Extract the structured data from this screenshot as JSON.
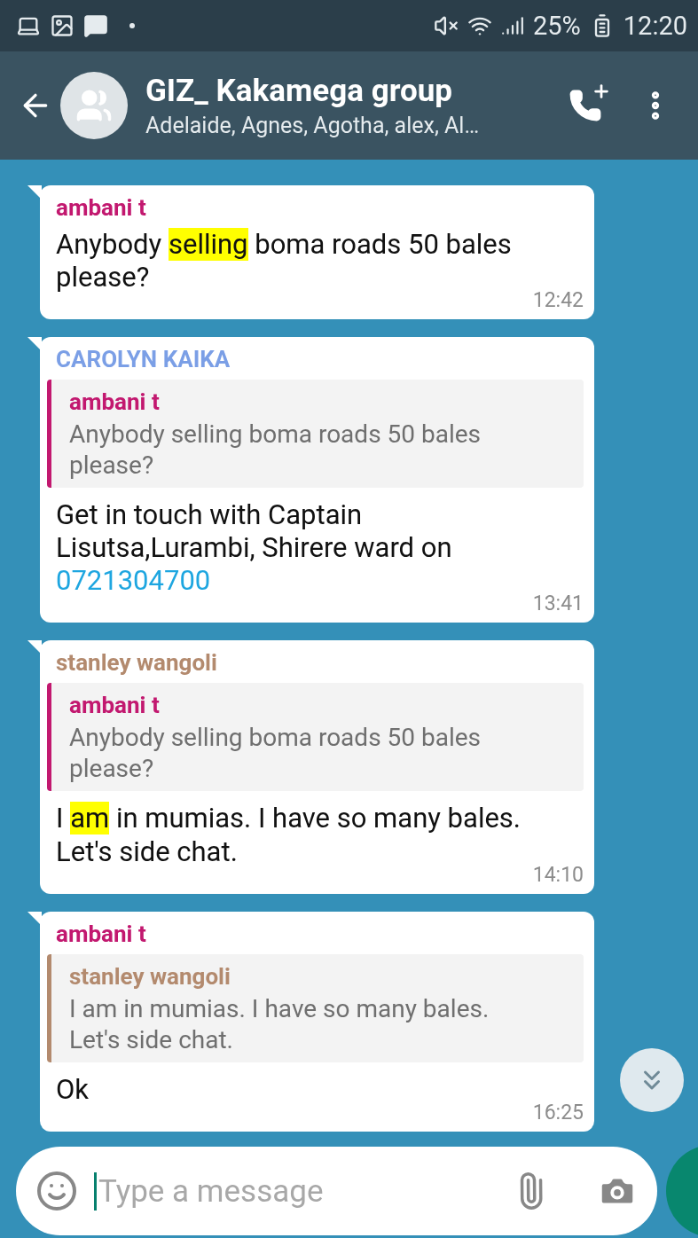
{
  "status_bar": {
    "battery": "25%",
    "time": "12:20"
  },
  "header": {
    "title": "GIZ_ Kakamega group",
    "subtitle": "Adelaide, Agnes, Agotha, alex, Al…"
  },
  "messages": [
    {
      "sender": "ambani t",
      "color": "#c2186f",
      "parts": [
        {
          "kind": "text",
          "text": "Anybody "
        },
        {
          "kind": "highlight",
          "text": "selling"
        },
        {
          "kind": "text",
          "text": " boma roads 50 bales please?"
        }
      ],
      "time": "12:42"
    },
    {
      "sender": "CAROLYN KAIKA",
      "color": "#7b9fe6",
      "quote": {
        "sender": "ambani t",
        "color": "#c2186f",
        "text": "Anybody selling boma roads 50 bales please?"
      },
      "parts": [
        {
          "kind": "text",
          "text": "Get in touch with Captain Lisutsa,Lurambi, Shirere ward on "
        },
        {
          "kind": "link",
          "text": "0721304700"
        }
      ],
      "time": "13:41"
    },
    {
      "sender": "stanley wangoli",
      "color": "#b38a6e",
      "quote": {
        "sender": "ambani t",
        "color": "#c2186f",
        "text": "Anybody selling boma roads 50 bales please?"
      },
      "parts": [
        {
          "kind": "text",
          "text": "I "
        },
        {
          "kind": "highlight",
          "text": "am"
        },
        {
          "kind": "text",
          "text": " in mumias. I have so many bales. Let's side chat."
        }
      ],
      "time": "14:10"
    },
    {
      "sender": "ambani t",
      "color": "#c2186f",
      "quote": {
        "sender": "stanley wangoli",
        "color": "#b38a6e",
        "text": "I am in mumias. I have so many bales. Let's side chat."
      },
      "parts": [
        {
          "kind": "text",
          "text": "Ok"
        }
      ],
      "time": "16:25"
    }
  ],
  "composer": {
    "placeholder": "Type a message"
  }
}
